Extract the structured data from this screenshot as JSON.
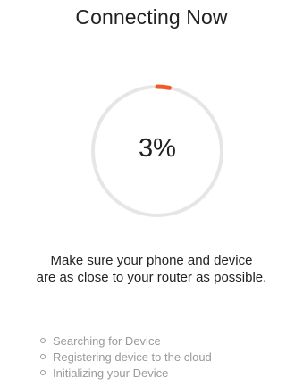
{
  "header": {
    "title": "Connecting Now"
  },
  "progress": {
    "label": "3%",
    "fraction": 0.03,
    "track_color": "#e6e6e6",
    "fill_color": "#f05a28"
  },
  "instructions": {
    "line1": "Make sure your phone and device",
    "line2": "are as close to your router as possible."
  },
  "steps": [
    {
      "label": "Searching for Device",
      "icon": "circle-outline-icon"
    },
    {
      "label": "Registering device to the cloud",
      "icon": "circle-outline-icon"
    },
    {
      "label": "Initializing your Device",
      "icon": "circle-outline-icon"
    }
  ]
}
